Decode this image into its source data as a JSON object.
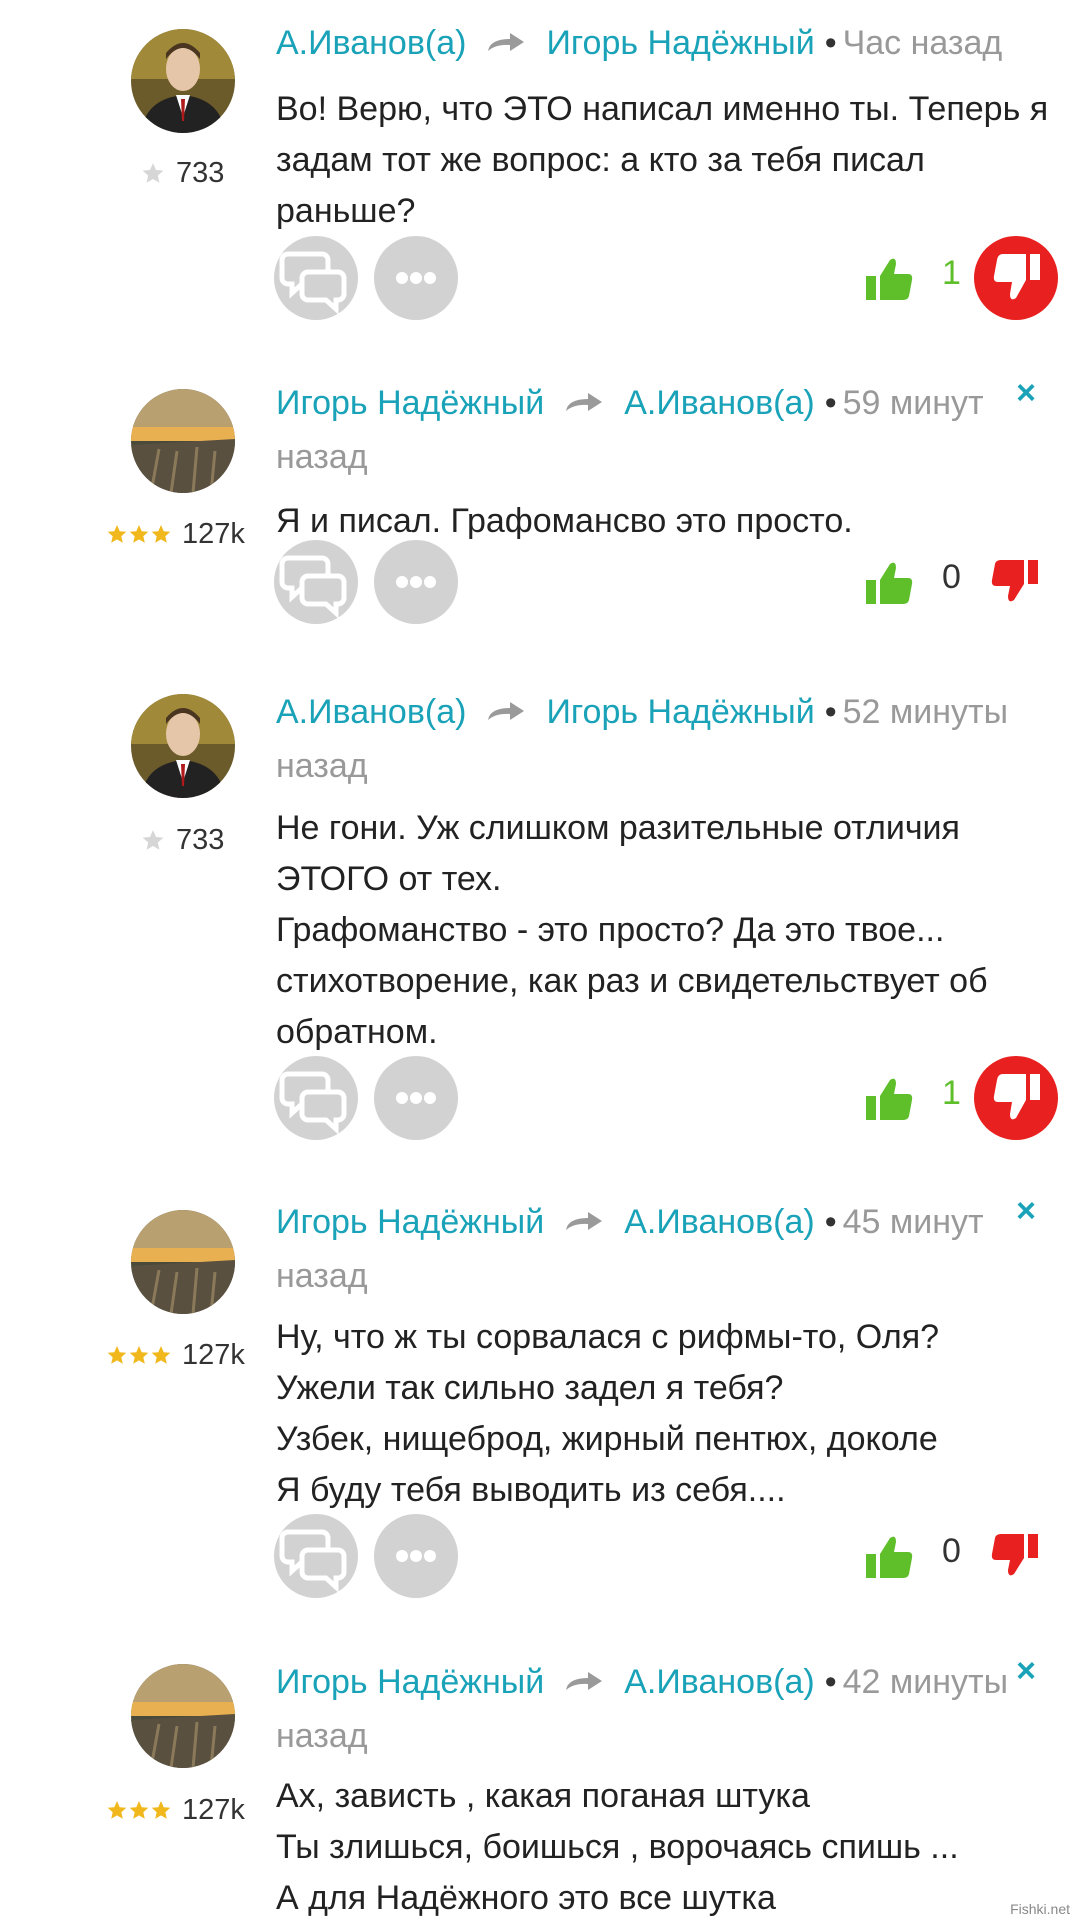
{
  "comments": [
    {
      "author": "А.Иванов(а)",
      "reply_to": "Игорь Надёжный",
      "time": "Час назад",
      "rating": "733",
      "rating_stars": "silver",
      "lines": [
        "Во! Верю, что ЭТО написал именно ты. Теперь я",
        "задам тот же вопрос: а кто за тебя писал",
        "раньше?"
      ],
      "likes": "1",
      "disliked": true,
      "closable": false
    },
    {
      "author": "Игорь Надёжный",
      "reply_to": "А.Иванов(а)",
      "time": "59 минут",
      "time_2": "назад",
      "rating": "127k",
      "rating_stars": "gold",
      "lines": [
        "Я и писал. Графомансво это просто."
      ],
      "likes": "0",
      "disliked": false,
      "closable": true,
      "close_label": "×"
    },
    {
      "author": "А.Иванов(а)",
      "reply_to": "Игорь Надёжный",
      "time": "52 минуты",
      "time_2": "назад",
      "rating": "733",
      "rating_stars": "silver",
      "lines": [
        "Не гони. Уж слишком разительные отличия",
        "ЭТОГО от тех.",
        "Графоманство - это просто? Да это твое...",
        "стихотворение, как раз и свидетельствует об",
        "обратном."
      ],
      "likes": "1",
      "disliked": true,
      "closable": false
    },
    {
      "author": "Игорь Надёжный",
      "reply_to": "А.Иванов(а)",
      "time": "45 минут",
      "time_2": "назад",
      "rating": "127k",
      "rating_stars": "gold",
      "lines": [
        "Ну, что ж ты сорвалася с рифмы-то, Оля?",
        "Ужели так сильно задел я тебя?",
        "Узбек, нищеброд, жирный пентюх, доколе",
        "Я буду тебя выводить из себя...."
      ],
      "likes": "0",
      "disliked": false,
      "closable": true,
      "close_label": "×"
    },
    {
      "author": "Игорь Надёжный",
      "reply_to": "А.Иванов(а)",
      "time": "42 минуты",
      "time_2": "назад",
      "rating": "127k",
      "rating_stars": "gold",
      "lines": [
        "Ах, зависть , какая поганая штука",
        "Ты злишься, боишься , ворочаясь спишь ...",
        "А для Надёжного это все шутка"
      ],
      "closable": true,
      "close_label": "×"
    }
  ],
  "colors": {
    "link": "#1aa3b8",
    "like_green": "#5fbf2a",
    "dislike_red": "#e8201f",
    "button_gray": "#d2d2d2"
  },
  "icons": [
    "reply-icon",
    "more-icon",
    "thumbs-up-icon",
    "thumbs-down-icon",
    "reply-arrow-icon",
    "star-icon",
    "close-icon"
  ],
  "watermark": "Fishki.net"
}
